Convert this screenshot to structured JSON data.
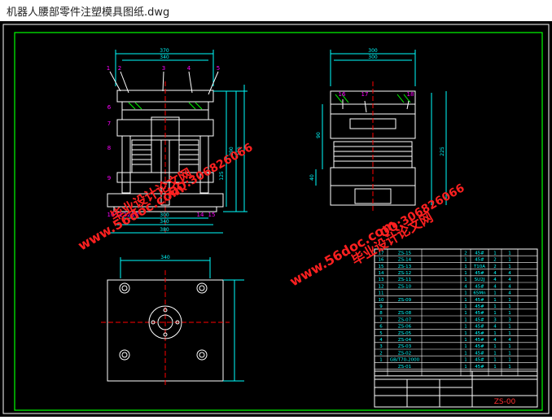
{
  "window": {
    "title": "机器人腰部零件注塑模具图纸.dwg"
  },
  "colors": {
    "background": "#000000",
    "frame": "#00ff00",
    "outline": "#ffffff",
    "dimension": "#00ffff",
    "centerline": "#ff0000",
    "balloon": "#ff00ff",
    "hatch": "#00ff00",
    "watermark": "#ff2020"
  },
  "watermarks": {
    "site_left": "www.56doc.com",
    "qq_left": "QQ:306826066",
    "brand_left": "毕业设计论文网",
    "site_right": "www.56doc.com",
    "qq_right": "QQ:306826066",
    "brand_right": "毕业设计论文网"
  },
  "dimensions": {
    "front_top_outer": "370",
    "front_top_inner": "340",
    "front_bottom_mid": "300",
    "front_bottom_a": "340",
    "front_bottom_b": "380",
    "front_height_1": "320",
    "front_height_2": "290",
    "front_height_3": "125",
    "side_top_outer": "300",
    "side_top_inner": "300",
    "side_height": "225",
    "side_a": "90",
    "side_b": "40",
    "plan_width": "340"
  },
  "balloons": {
    "front_top": [
      "1",
      "2",
      "3",
      "4",
      "5"
    ],
    "front_left": [
      "6",
      "7",
      "8",
      "9"
    ],
    "front_bottom": [
      "10",
      "11",
      "12",
      "13",
      "14",
      "15"
    ],
    "side_top": [
      "16",
      "17",
      "18"
    ]
  },
  "bom": {
    "rows": [
      [
        "17",
        "ZS-15",
        "",
        "2",
        "45#",
        "1",
        "1"
      ],
      [
        "16",
        "ZS-14",
        "",
        "1",
        "45#",
        "2",
        "1"
      ],
      [
        "15",
        "ZS-13",
        "",
        "1",
        "T10A",
        "2",
        "1"
      ],
      [
        "14",
        "ZS-12",
        "",
        "1",
        "45#",
        "4",
        "4"
      ],
      [
        "13",
        "ZS-11",
        "",
        "1",
        "SU2J",
        "4",
        "4"
      ],
      [
        "12",
        "ZS-10",
        "",
        "4",
        "45#",
        "4",
        "4"
      ],
      [
        "11",
        "",
        "",
        "1",
        "65Mn",
        "1",
        "4"
      ],
      [
        "10",
        "ZS-09",
        "",
        "1",
        "45#",
        "1",
        "1"
      ],
      [
        "9",
        "",
        "",
        "1",
        "45#",
        "1",
        "1"
      ],
      [
        "8",
        "ZS-08",
        "",
        "1",
        "45#",
        "1",
        "1"
      ],
      [
        "7",
        "ZS-07",
        "",
        "1",
        "45#",
        "3",
        "3"
      ],
      [
        "6",
        "ZS-06",
        "",
        "1",
        "45#",
        "4",
        "1"
      ],
      [
        "5",
        "ZS-05",
        "",
        "1",
        "45#",
        "1",
        "1"
      ],
      [
        "4",
        "ZS-04",
        "",
        "1",
        "45#",
        "4",
        "4"
      ],
      [
        "3",
        "ZS-03",
        "",
        "1",
        "45#",
        "1",
        "1"
      ],
      [
        "2",
        "ZS-02",
        "",
        "1",
        "45#",
        "1",
        "1"
      ],
      [
        "1",
        "GB/T70-2000",
        "",
        "1",
        "45#",
        "1",
        "1"
      ],
      [
        "",
        "ZS-01",
        "",
        "1",
        "45#",
        "1",
        "1"
      ]
    ],
    "drawing_no": "ZS-00"
  }
}
